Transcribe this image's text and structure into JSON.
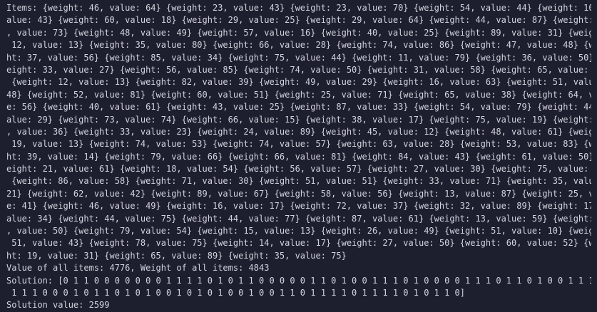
{
  "terminal": {
    "lines": [
      "Items: {weight: 46, value: 64} {weight: 23, value: 43} {weight: 23, value: 70} {weight: 54, value: 44} {weight: 10, v",
      "alue: 43} {weight: 60, value: 18} {weight: 29, value: 25} {weight: 29, value: 64} {weight: 44, value: 87} {weight: 73",
      ", value: 73} {weight: 48, value: 49} {weight: 57, value: 16} {weight: 40, value: 25} {weight: 89, value: 31} {weight:",
      " 12, value: 13} {weight: 35, value: 80} {weight: 66, value: 28} {weight: 74, value: 86} {weight: 47, value: 48} {weig",
      "ht: 37, value: 56} {weight: 85, value: 34} {weight: 75, value: 44} {weight: 11, value: 79} {weight: 36, value: 50} {w",
      "eight: 33, value: 27} {weight: 56, value: 85} {weight: 74, value: 50} {weight: 31, value: 58} {weight: 65, value: 34}",
      " {weight: 12, value: 13} {weight: 82, value: 39} {weight: 49, value: 29} {weight: 16, value: 63} {weight: 51, value:",
      "48} {weight: 52, value: 81} {weight: 60, value: 51} {weight: 25, value: 71} {weight: 65, value: 38} {weight: 64, valu",
      "e: 56} {weight: 40, value: 61} {weight: 43, value: 25} {weight: 87, value: 33} {weight: 54, value: 79} {weight: 44, v",
      "alue: 29} {weight: 73, value: 74} {weight: 66, value: 15} {weight: 38, value: 17} {weight: 75, value: 19} {weight: 14",
      ", value: 36} {weight: 33, value: 23} {weight: 24, value: 89} {weight: 45, value: 12} {weight: 48, value: 61} {weight:",
      " 19, value: 13} {weight: 74, value: 53} {weight: 74, value: 57} {weight: 63, value: 28} {weight: 53, value: 83} {weig",
      "ht: 39, value: 14} {weight: 79, value: 66} {weight: 66, value: 81} {weight: 84, value: 43} {weight: 61, value: 50} {w",
      "eight: 21, value: 61} {weight: 18, value: 54} {weight: 56, value: 57} {weight: 27, value: 30} {weight: 75, value: 37}",
      " {weight: 86, value: 58} {weight: 71, value: 30} {weight: 51, value: 51} {weight: 33, value: 71} {weight: 35, value:",
      "21} {weight: 62, value: 42} {weight: 89, value: 67} {weight: 58, value: 56} {weight: 13, value: 87} {weight: 25, valu",
      "e: 41} {weight: 46, value: 49} {weight: 16, value: 17} {weight: 72, value: 37} {weight: 32, value: 89} {weight: 17, v",
      "alue: 34} {weight: 44, value: 75} {weight: 44, value: 77} {weight: 87, value: 61} {weight: 13, value: 59} {weight: 31",
      ", value: 50} {weight: 79, value: 54} {weight: 15, value: 13} {weight: 26, value: 49} {weight: 51, value: 10} {weight:",
      " 51, value: 43} {weight: 78, value: 75} {weight: 14, value: 17} {weight: 27, value: 50} {weight: 60, value: 52} {weig",
      "ht: 19, value: 31} {weight: 65, value: 89} {weight: 35, value: 75}",
      "Value of all items: 4776, Weight of all items: 4843",
      "Solution: [0 1 1 0 0 0 0 0 0 0 1 1 1 1 0 1 0 1 1 0 0 0 0 0 1 1 0 1 0 0 1 1 1 0 1 0 0 0 0 1 1 1 0 1 1 0 1 0 0 1 1 1",
      " 1 1 1 0 0 0 1 0 1 1 0 1 0 1 0 0 1 0 1 0 1 0 0 1 0 0 1 1 0 1 1 1 1 0 1 1 1 1 0 1 0 1 1 0]",
      "Solution value: 2599"
    ]
  }
}
